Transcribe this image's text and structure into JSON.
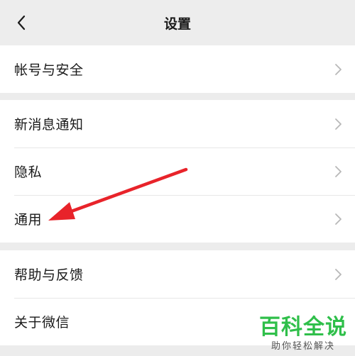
{
  "header": {
    "title": "设置",
    "back_icon": "chevron-left-icon"
  },
  "sections": [
    {
      "items": [
        {
          "label": "帐号与安全"
        }
      ]
    },
    {
      "items": [
        {
          "label": "新消息通知"
        },
        {
          "label": "隐私"
        },
        {
          "label": "通用"
        }
      ]
    },
    {
      "items": [
        {
          "label": "帮助与反馈"
        },
        {
          "label": "关于微信"
        }
      ]
    }
  ],
  "annotation": {
    "arrow_color": "#e8232a"
  },
  "watermark": {
    "main": "百科全说",
    "sub": "助你轻松解决"
  },
  "colors": {
    "background": "#ececec",
    "card": "#ffffff",
    "watermark_green": "#2fbf4a"
  }
}
